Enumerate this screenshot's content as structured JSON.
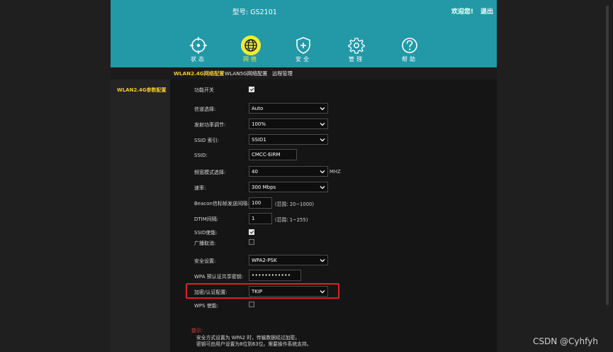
{
  "header": {
    "model": "型号: GS2101",
    "welcome": "欢迎您!",
    "logout": "退出"
  },
  "nav": [
    {
      "label": "状态",
      "icon": "target-icon"
    },
    {
      "label": "网络",
      "icon": "globe-icon",
      "active": true
    },
    {
      "label": "安全",
      "icon": "shield-plus-icon"
    },
    {
      "label": "管理",
      "icon": "gear-icon"
    },
    {
      "label": "帮助",
      "icon": "question-icon"
    }
  ],
  "tabs": [
    {
      "label": "WLAN2.4G网络配置",
      "active": true
    },
    {
      "label": "WLAN5G网络配置"
    },
    {
      "label": "远程管理"
    }
  ],
  "sidebar": {
    "item": "WLAN2.4G参数配置"
  },
  "form": {
    "enable_label": "功能开关",
    "enable_checked": true,
    "channel_label": "信道选择:",
    "channel_value": "Auto",
    "power_label": "发射功率调节:",
    "power_value": "100%",
    "ssid_index_label": "SSID 索引:",
    "ssid_index_value": "SSID1",
    "ssid_label": "SSID:",
    "ssid_value": "CMCC-EiRM",
    "bandwidth_label": "频宽模式选择:",
    "bandwidth_value": "40",
    "bandwidth_unit": "MHZ",
    "rate_label": "速率:",
    "rate_value": "300 Mbps",
    "beacon_label": "Beacon信标帧发送间隔:",
    "beacon_value": "100",
    "beacon_hint": "(范围: 20~1000)",
    "dtim_label": "DTIM间隔:",
    "dtim_value": "1",
    "dtim_hint": "(范围: 1~255)",
    "ssid_enable_label": "SSID使能:",
    "ssid_enable_checked": true,
    "broadcast_cancel_label": "广播取消:",
    "broadcast_cancel_checked": false,
    "security_label": "安全设置:",
    "security_value": "WPA2-PSK",
    "wpa_key_label": "WPA 预认证共享密钥:",
    "wpa_key_value": "••••••••••••",
    "encryption_label": "加密/认证配置:",
    "encryption_value": "TKIP",
    "wps_label": "WPS 使能:",
    "wps_checked": false
  },
  "tip": {
    "title": "提示:",
    "line1": "安全方式设置为 WPA2 时，传输数据经过加密。",
    "line2": "密钥可由用户设置为8位到63位。需要操作系统支持。"
  },
  "watermark": "CSDN @Cyhfyh",
  "colors": {
    "header_bg": "#2399a8",
    "accent": "#f0c830",
    "active_nav": "#ecea3b",
    "highlight": "#e02020"
  }
}
